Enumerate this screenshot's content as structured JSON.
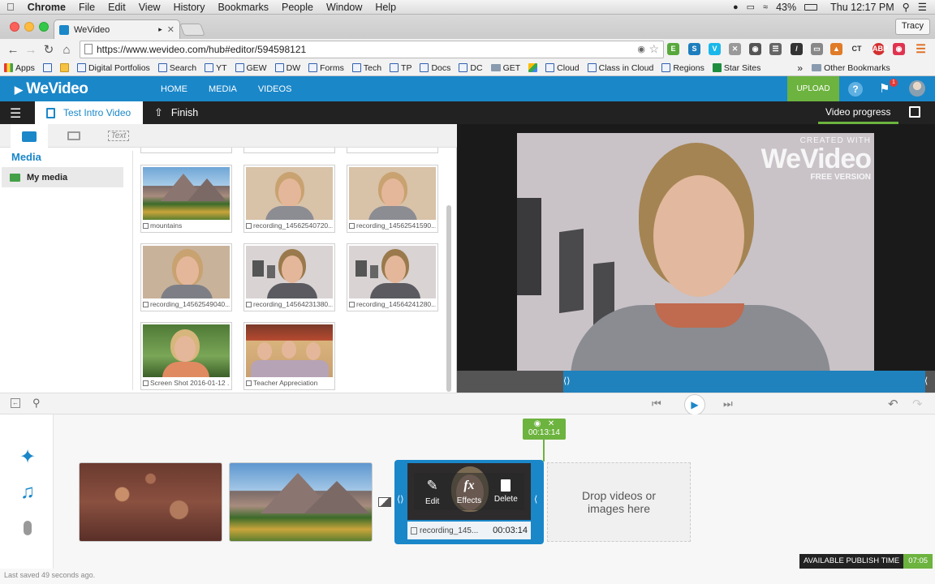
{
  "macmenu": {
    "items": [
      "Chrome",
      "File",
      "Edit",
      "View",
      "History",
      "Bookmarks",
      "People",
      "Window",
      "Help"
    ],
    "battery": "43%",
    "clock": "Thu 12:17 PM"
  },
  "browser": {
    "tab_title": "WeVideo",
    "profile": "Tracy",
    "url": "https://www.wevideo.com/hub#editor/594598121",
    "bookmarks": [
      {
        "label": "Apps",
        "kind": "apps"
      },
      {
        "label": "",
        "kind": "page"
      },
      {
        "label": "Digital Portfolios",
        "kind": "page"
      },
      {
        "label": "Search",
        "kind": "page"
      },
      {
        "label": "YT",
        "kind": "page"
      },
      {
        "label": "GEW",
        "kind": "page"
      },
      {
        "label": "DW",
        "kind": "page"
      },
      {
        "label": "Forms",
        "kind": "page"
      },
      {
        "label": "Tech",
        "kind": "page"
      },
      {
        "label": "TP",
        "kind": "page"
      },
      {
        "label": "Docs",
        "kind": "page"
      },
      {
        "label": "DC",
        "kind": "page"
      },
      {
        "label": "GET",
        "kind": "folder"
      },
      {
        "label": "",
        "kind": "drive"
      },
      {
        "label": "Cloud",
        "kind": "page"
      },
      {
        "label": "Class in Cloud",
        "kind": "page"
      },
      {
        "label": "Regions",
        "kind": "page"
      },
      {
        "label": "Star Sites",
        "kind": "page"
      }
    ],
    "other_bookmarks": "Other Bookmarks",
    "overflow": "»"
  },
  "app": {
    "logo": "WeVideo",
    "nav": [
      "HOME",
      "MEDIA",
      "VIDEOS"
    ],
    "upload": "UPLOAD",
    "notif_count": "1",
    "project_name": "Test Intro Video",
    "finish": "Finish",
    "video_progress": "Video progress"
  },
  "media": {
    "text_tab": "Text",
    "heading": "Media",
    "my_media": "My media",
    "items": [
      {
        "caption": "mountains",
        "kind": "mountain"
      },
      {
        "caption": "recording_14562540720...",
        "kind": "face1"
      },
      {
        "caption": "recording_14562541590...",
        "kind": "face1"
      },
      {
        "caption": "recording_14562549040...",
        "kind": "face2"
      },
      {
        "caption": "recording_14564231380...",
        "kind": "face3"
      },
      {
        "caption": "recording_14564241280...",
        "kind": "face3"
      },
      {
        "caption": "Screen Shot 2016-01-12 ...",
        "kind": "face4"
      },
      {
        "caption": "Teacher Appreciation",
        "kind": "kids"
      }
    ]
  },
  "preview": {
    "watermark_top": "CREATED WITH",
    "watermark_logo": "WeVideo",
    "watermark_bottom": "FREE VERSION"
  },
  "timeline": {
    "marker_time": "00:13:14",
    "clip_actions": [
      "Edit",
      "Effects",
      "Delete"
    ],
    "clip_name": "recording_145...",
    "clip_duration": "00:03:14",
    "drop_text": "Drop videos or images here",
    "publish_label": "AVAILABLE PUBLISH TIME",
    "publish_time": "07:05",
    "status": "Last saved 49 seconds ago."
  },
  "colors": {
    "brand": "#1a87c9",
    "accent_green": "#6db33f"
  }
}
